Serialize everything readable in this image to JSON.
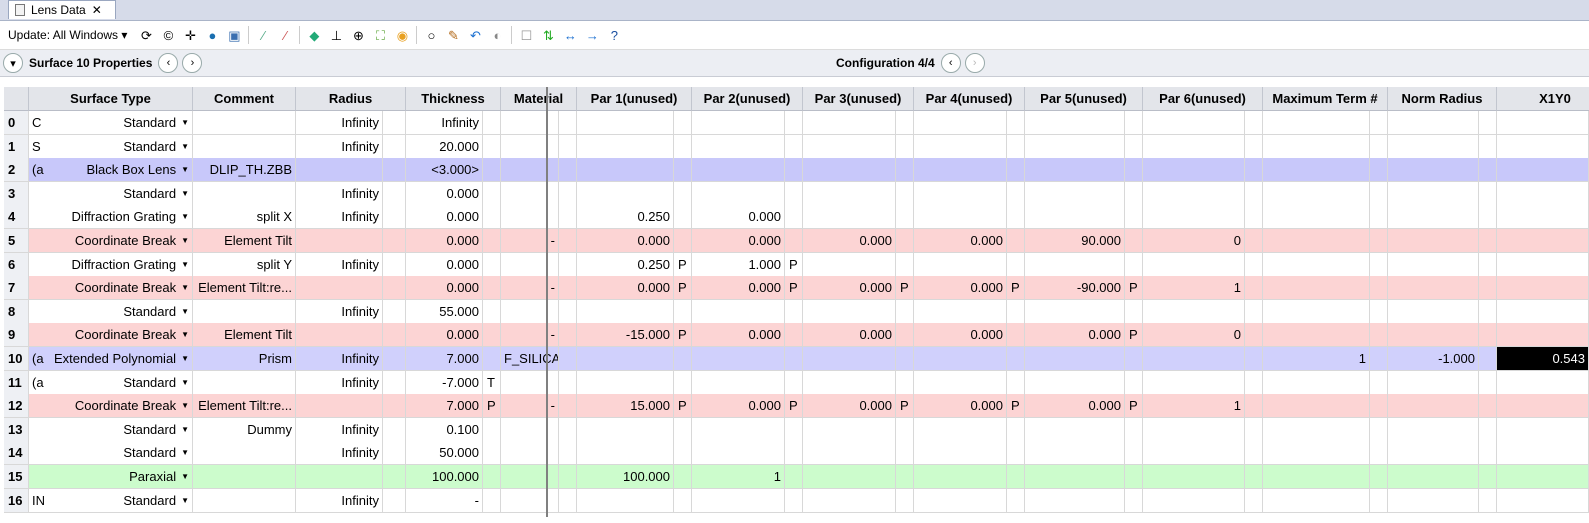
{
  "tab": {
    "title": "Lens Data",
    "close": "✕"
  },
  "toolbar": {
    "update_label": "Update: All Windows ▾"
  },
  "nav": {
    "surface_label": "Surface  10 Properties",
    "config_label": "Configuration 4/4"
  },
  "columns": [
    "",
    "Surface Type",
    "Comment",
    "Radius",
    "",
    "Thickness",
    "",
    "Material",
    "",
    "Par 1(unused)",
    "",
    "Par 2(unused)",
    "",
    "Par 3(unused)",
    "",
    "Par 4(unused)",
    "",
    "Par 5(unused)",
    "",
    "Par 6(unused)",
    "",
    "Maximum Term #",
    "",
    "Norm Radius",
    "",
    "X1Y0",
    ""
  ],
  "rows": [
    {
      "color": "#ffffff",
      "cells": [
        "0",
        "C",
        "Standard",
        "",
        "Infinity",
        "",
        "Infinity",
        "",
        "",
        "",
        "",
        "",
        "",
        "",
        "",
        "",
        "",
        "",
        "",
        "",
        "",
        "",
        "",
        "",
        "",
        "",
        "",
        ""
      ]
    },
    {
      "color": "#ffffff",
      "cells": [
        "1",
        "S",
        "Standard",
        "",
        "Infinity",
        "",
        "20.000",
        "",
        "",
        "",
        "",
        "",
        "",
        "",
        "",
        "",
        "",
        "",
        "",
        "",
        "",
        "",
        "",
        "",
        "",
        "",
        "",
        ""
      ]
    },
    {
      "color": "#c8c8fa",
      "cells": [
        "2",
        "(a",
        "Black Box Lens",
        "DLIP_TH.ZBB",
        "",
        "",
        "<3.000>",
        "",
        "",
        "",
        "",
        "",
        "",
        "",
        "",
        "",
        "",
        "",
        "",
        "",
        "",
        "",
        "",
        "",
        "",
        "",
        "",
        ""
      ]
    },
    {
      "color": "#ffffff",
      "cells": [
        "3",
        "",
        "Standard",
        "",
        "Infinity",
        "",
        "0.000",
        "",
        "",
        "",
        "",
        "",
        "",
        "",
        "",
        "",
        "",
        "",
        "",
        "",
        "",
        "",
        "",
        "",
        "",
        "",
        "",
        ""
      ]
    },
    {
      "color": "#ffffff",
      "cells": [
        "4",
        "",
        "Diffraction Grating",
        "split X",
        "Infinity",
        "",
        "0.000",
        "",
        "",
        "",
        "0.250",
        "",
        "0.000",
        "",
        "",
        "",
        "",
        "",
        "",
        "",
        "",
        "",
        "",
        "",
        "",
        "",
        "",
        ""
      ]
    },
    {
      "color": "#fcd4d4",
      "cells": [
        "5",
        "",
        "Coordinate Break",
        "Element Tilt",
        "",
        "",
        "0.000",
        "",
        "-",
        "",
        "0.000",
        "",
        "0.000",
        "",
        "0.000",
        "",
        "0.000",
        "",
        "90.000",
        "",
        "0",
        "",
        "",
        "",
        "",
        "",
        "",
        ""
      ]
    },
    {
      "color": "#ffffff",
      "cells": [
        "6",
        "",
        "Diffraction Grating",
        "split Y",
        "Infinity",
        "",
        "0.000",
        "",
        "",
        "",
        "0.250",
        "P",
        "1.000",
        "P",
        "",
        "",
        "",
        "",
        "",
        "",
        "",
        "",
        "",
        "",
        "",
        "",
        "",
        ""
      ]
    },
    {
      "color": "#fcd4d4",
      "cells": [
        "7",
        "",
        "Coordinate Break",
        "Element Tilt:re...",
        "",
        "",
        "0.000",
        "",
        "-",
        "",
        "0.000",
        "P",
        "0.000",
        "P",
        "0.000",
        "P",
        "0.000",
        "P",
        "-90.000",
        "P",
        "1",
        "",
        "",
        "",
        "",
        "",
        "",
        ""
      ]
    },
    {
      "color": "#ffffff",
      "cells": [
        "8",
        "",
        "Standard",
        "",
        "Infinity",
        "",
        "55.000",
        "",
        "",
        "",
        "",
        "",
        "",
        "",
        "",
        "",
        "",
        "",
        "",
        "",
        "",
        "",
        "",
        "",
        "",
        "",
        "",
        ""
      ]
    },
    {
      "color": "#fcd4d4",
      "cells": [
        "9",
        "",
        "Coordinate Break",
        "Element Tilt",
        "",
        "",
        "0.000",
        "",
        "-",
        "",
        "-15.000",
        "P",
        "0.000",
        "",
        "0.000",
        "",
        "0.000",
        "",
        "0.000",
        "P",
        "0",
        "",
        "",
        "",
        "",
        "",
        "",
        ""
      ]
    },
    {
      "color": "#d0d0fc",
      "cells": [
        "10",
        "(a",
        "Extended Polynomial",
        "Prism",
        "Infinity",
        "",
        "7.000",
        "",
        "F_SILICA",
        "",
        "",
        "",
        "",
        "",
        "",
        "",
        "",
        "",
        "",
        "",
        "",
        "",
        "1",
        "",
        "-1.000",
        "",
        "0.543",
        ""
      ]
    },
    {
      "color": "#ffffff",
      "cells": [
        "11",
        "(a",
        "Standard",
        "",
        "Infinity",
        "",
        "-7.000",
        "T",
        "",
        "",
        "",
        "",
        "",
        "",
        "",
        "",
        "",
        "",
        "",
        "",
        "",
        "",
        "",
        "",
        "",
        "",
        "",
        ""
      ]
    },
    {
      "color": "#fcd4d4",
      "cells": [
        "12",
        "",
        "Coordinate Break",
        "Element Tilt:re...",
        "",
        "",
        "7.000",
        "P",
        "-",
        "",
        "15.000",
        "P",
        "0.000",
        "P",
        "0.000",
        "P",
        "0.000",
        "P",
        "0.000",
        "P",
        "1",
        "",
        "",
        "",
        "",
        "",
        "",
        ""
      ]
    },
    {
      "color": "#ffffff",
      "cells": [
        "13",
        "",
        "Standard",
        "Dummy",
        "Infinity",
        "",
        "0.100",
        "",
        "",
        "",
        "",
        "",
        "",
        "",
        "",
        "",
        "",
        "",
        "",
        "",
        "",
        "",
        "",
        "",
        "",
        "",
        "",
        ""
      ]
    },
    {
      "color": "#ffffff",
      "cells": [
        "14",
        "",
        "Standard",
        "",
        "Infinity",
        "",
        "50.000",
        "",
        "",
        "",
        "",
        "",
        "",
        "",
        "",
        "",
        "",
        "",
        "",
        "",
        "",
        "",
        "",
        "",
        "",
        "",
        "",
        ""
      ]
    },
    {
      "color": "#ccfccc",
      "cells": [
        "15",
        "",
        "Paraxial",
        "",
        "",
        "",
        "100.000",
        "",
        "",
        "",
        "100.000",
        "",
        "1",
        "",
        "",
        "",
        "",
        "",
        "",
        "",
        "",
        "",
        "",
        "",
        "",
        "",
        "",
        ""
      ]
    },
    {
      "color": "#ffffff",
      "cells": [
        "16",
        "IN",
        "Standard",
        "",
        "Infinity",
        "",
        "-",
        "",
        "",
        "",
        "",
        "",
        "",
        "",
        "",
        "",
        "",
        "",
        "",
        "",
        "",
        "",
        "",
        "",
        "",
        "",
        "",
        ""
      ]
    }
  ]
}
